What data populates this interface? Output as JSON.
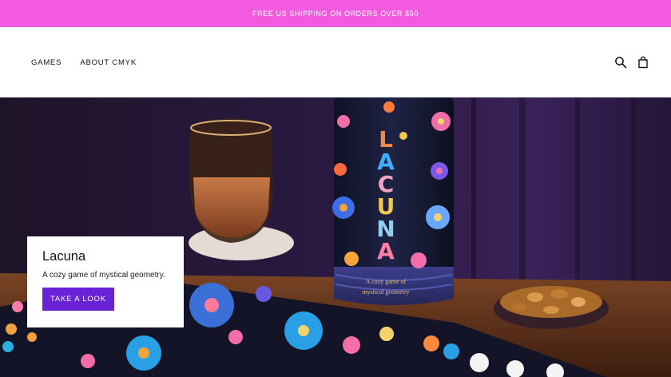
{
  "announcement": {
    "text": "FREE US SHIPPING ON ORDERS OVER $50",
    "bg_color": "#f25be0"
  },
  "nav": {
    "items": [
      {
        "label": "GAMES"
      },
      {
        "label": "ABOUT CMYK"
      }
    ]
  },
  "header_icons": [
    "search-icon",
    "shopping-bag-icon"
  ],
  "hero": {
    "title": "Lacuna",
    "subtitle": "A cozy game of mystical geometry.",
    "cta_label": "TAKE A LOOK",
    "cta_color": "#6a22d6",
    "tube_title_letters": [
      "L",
      "A",
      "C",
      "U",
      "N",
      "A"
    ],
    "tube_caption_lines": [
      "A cozy game of",
      "mystical geometry"
    ],
    "tube_color": "#1b1f3a",
    "table_color": "#5a2f1a",
    "curtain_color": "#2a1740"
  }
}
